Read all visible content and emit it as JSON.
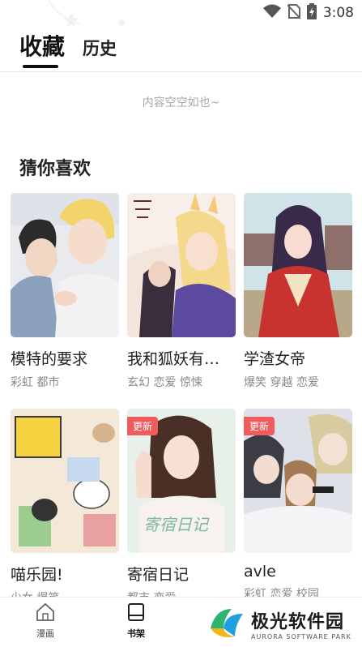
{
  "status_bar": {
    "time": "3:08",
    "icons": [
      "wifi-icon",
      "no-sim-icon",
      "battery-charging-icon"
    ]
  },
  "tabs": [
    {
      "label": "收藏",
      "active": true
    },
    {
      "label": "历史",
      "active": false
    }
  ],
  "empty_message": "内容空空如也~",
  "recommend": {
    "title": "猜你喜欢",
    "items": [
      {
        "title": "模特的要求",
        "tags": "彩虹 都市",
        "badge": ""
      },
      {
        "title": "我和狐妖有…",
        "tags": "玄幻 恋爱 惊悚",
        "badge": ""
      },
      {
        "title": "学渣女帝",
        "tags": "爆笑 穿越 恋爱",
        "badge": ""
      },
      {
        "title": "喵乐园!",
        "tags": "少女 爆笑",
        "badge": ""
      },
      {
        "title": "寄宿日记",
        "tags": "都市 恋爱",
        "badge": "更新"
      },
      {
        "title": "avle",
        "tags": "彩虹 恋爱 校园",
        "badge": "更新"
      }
    ]
  },
  "bottom_nav": [
    {
      "label": "漫画",
      "icon": "home-icon",
      "active": false
    },
    {
      "label": "书架",
      "icon": "bookshelf-icon",
      "active": true
    }
  ],
  "watermark": {
    "text": "极光软件园",
    "subtext": "AURORA SOFTWARE PARK"
  },
  "colors": {
    "badge": "#f05b5b",
    "accent": "#111111"
  }
}
